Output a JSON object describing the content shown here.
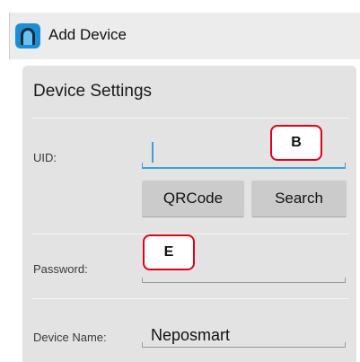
{
  "app": {
    "title": "Add Device",
    "icon": "app-logo-icon",
    "brand_color": "#1a8fd6"
  },
  "section": {
    "title": "Device Settings"
  },
  "fields": {
    "uid": {
      "label": "UID:",
      "value": ""
    },
    "password": {
      "label": "Password:",
      "value": ""
    },
    "device_name": {
      "label": "Device Name:",
      "value": "Neposmart"
    }
  },
  "buttons": {
    "qrcode": "QRCode",
    "search": "Search"
  },
  "markers": {
    "b": "B",
    "e": "E"
  },
  "colors": {
    "accent": "#3aa1d8",
    "marker_border": "#e0001a"
  }
}
